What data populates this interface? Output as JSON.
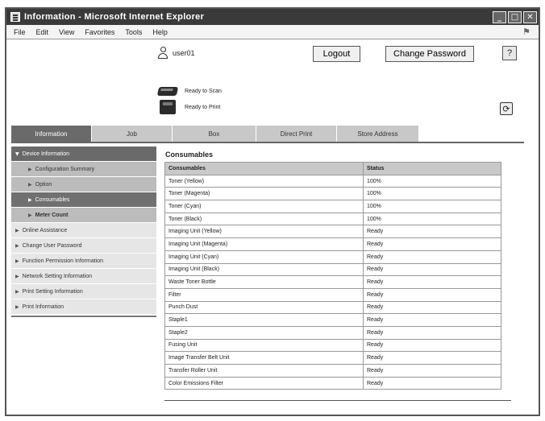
{
  "window": {
    "title": "Information - Microsoft Internet Explorer",
    "minimize": "_",
    "maximize": "□",
    "close": "✕"
  },
  "menu": [
    "File",
    "Edit",
    "View",
    "Favorites",
    "Tools",
    "Help"
  ],
  "header": {
    "user": "user01",
    "logout_label": "Logout",
    "change_password_label": "Change Password",
    "help_label": "?",
    "refresh_label": "⟳",
    "status_scan": "Ready to Scan",
    "status_print": "Ready to Print"
  },
  "tabs": [
    {
      "label": "Information",
      "width": 100
    },
    {
      "label": "Job",
      "width": 100
    },
    {
      "label": "Box",
      "width": 104
    },
    {
      "label": "Direct Print",
      "width": 100
    },
    {
      "label": "Store Address",
      "width": 102
    }
  ],
  "sidebar": {
    "items": [
      {
        "label": "Device Information",
        "kind": "header"
      },
      {
        "label": "Configuration Summary",
        "kind": "sub"
      },
      {
        "label": "Option",
        "kind": "sub"
      },
      {
        "label": "Consumables",
        "kind": "sub-active"
      },
      {
        "label": "Meter Count",
        "kind": "sub-bold"
      },
      {
        "label": "Online Assistance",
        "kind": "top"
      },
      {
        "label": "Change User Password",
        "kind": "top"
      },
      {
        "label": "Function Permission Information",
        "kind": "top"
      },
      {
        "label": "Network Setting Information",
        "kind": "top"
      },
      {
        "label": "Print Setting Information",
        "kind": "top"
      },
      {
        "label": "Print Information",
        "kind": "top"
      }
    ]
  },
  "main": {
    "section_title": "Consumables",
    "columns": [
      "Consumables",
      "Status"
    ],
    "rows": [
      [
        "Toner (Yellow)",
        "100%"
      ],
      [
        "Toner (Magenta)",
        "100%"
      ],
      [
        "Toner (Cyan)",
        "100%"
      ],
      [
        "Toner (Black)",
        "100%"
      ],
      [
        "Imaging Unit (Yellow)",
        "Ready"
      ],
      [
        "Imaging Unit (Magenta)",
        "Ready"
      ],
      [
        "Imaging Unit (Cyan)",
        "Ready"
      ],
      [
        "Imaging Unit (Black)",
        "Ready"
      ],
      [
        "Waste Toner Bottle",
        "Ready"
      ],
      [
        "Filter",
        "Ready"
      ],
      [
        "Punch Dust",
        "Ready"
      ],
      [
        "Staple1",
        "Ready"
      ],
      [
        "Staple2",
        "Ready"
      ],
      [
        "Fusing Unit",
        "Ready"
      ],
      [
        "Image Transfer Belt Unit",
        "Ready"
      ],
      [
        "Transfer Roller Unit",
        "Ready"
      ],
      [
        "Color Emissions Filter",
        "Ready"
      ]
    ]
  }
}
